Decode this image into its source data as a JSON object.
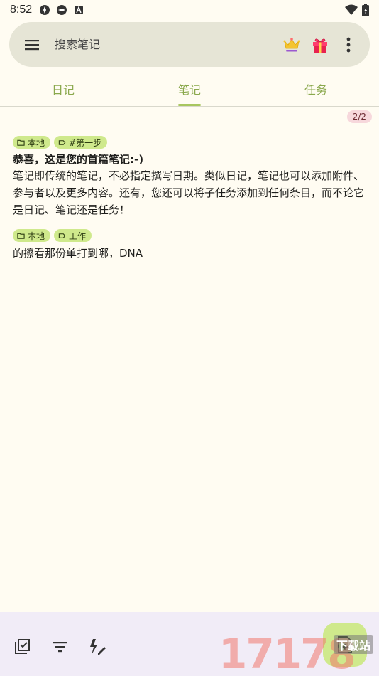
{
  "status_bar": {
    "time": "8:52"
  },
  "search": {
    "placeholder": "搜索笔记"
  },
  "tabs": [
    {
      "label": "日记",
      "active": false
    },
    {
      "label": "笔记",
      "active": true
    },
    {
      "label": "任务",
      "active": false
    }
  ],
  "count_badge": "2/2",
  "notes": [
    {
      "tags": [
        "本地",
        "#第一步"
      ],
      "title": "恭喜，这是您的首篇笔记:-)",
      "body": "笔记即传统的笔记，不必指定撰写日期。类似日记，笔记也可以添加附件、参与者以及更多内容。还有，您还可以将子任务添加到任何条目，而不论它是日记、笔记还是任务！"
    },
    {
      "tags": [
        "本地",
        "工作"
      ],
      "title": "",
      "body": "的擦看那份单打到哪，DNA"
    }
  ],
  "watermark": {
    "text": "17178",
    "sub": "下载站"
  },
  "colors": {
    "background": "#fffcf2",
    "search_bar": "#e6e5d6",
    "accent": "#8aa84c",
    "tag": "#cfe98c",
    "badge": "#f7d8dc",
    "bottom_bar": "#f1ecf7"
  }
}
